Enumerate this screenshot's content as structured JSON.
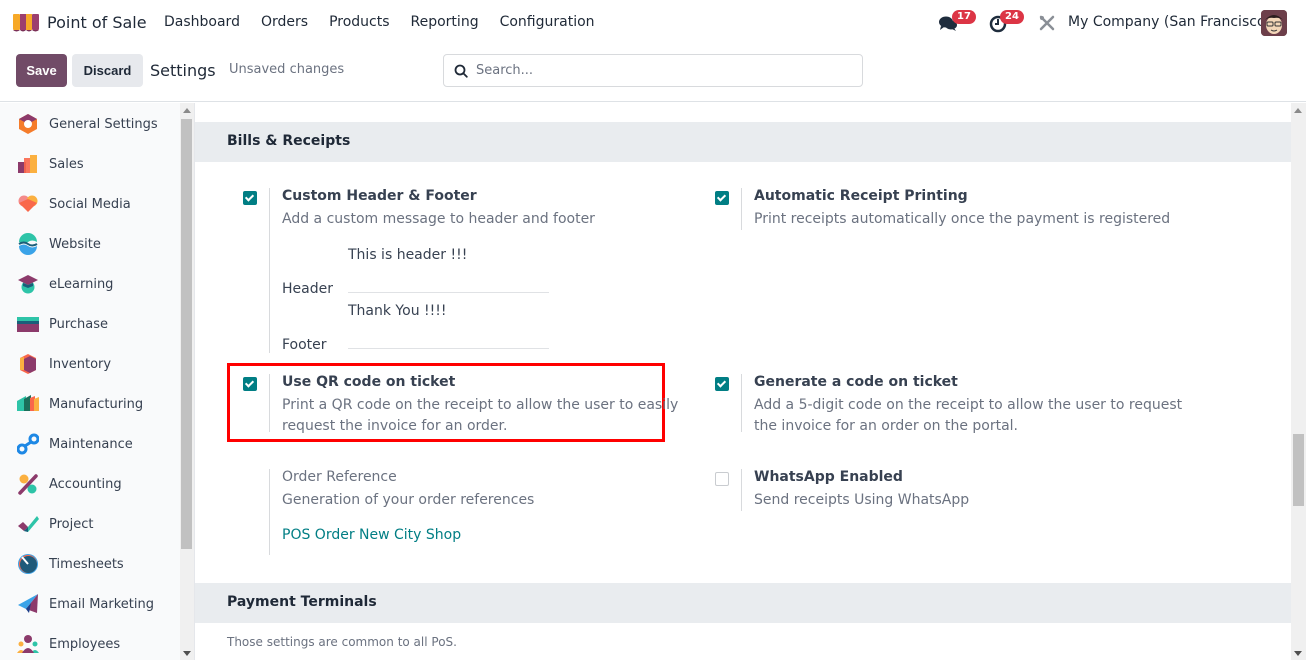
{
  "navbar": {
    "app_name": "Point of Sale",
    "menu": [
      "Dashboard",
      "Orders",
      "Products",
      "Reporting",
      "Configuration"
    ],
    "messages_count": "17",
    "activities_count": "24",
    "company": "My Company (San Francisco)"
  },
  "control_panel": {
    "save_label": "Save",
    "discard_label": "Discard",
    "title": "Settings",
    "status": "Unsaved changes",
    "search_placeholder": "Search..."
  },
  "sidebar": {
    "items": [
      {
        "label": "General Settings",
        "icon": "general-settings-icon"
      },
      {
        "label": "Sales",
        "icon": "sales-icon"
      },
      {
        "label": "Social Media",
        "icon": "social-media-icon"
      },
      {
        "label": "Website",
        "icon": "website-icon"
      },
      {
        "label": "eLearning",
        "icon": "elearning-icon"
      },
      {
        "label": "Purchase",
        "icon": "purchase-icon"
      },
      {
        "label": "Inventory",
        "icon": "inventory-icon"
      },
      {
        "label": "Manufacturing",
        "icon": "manufacturing-icon"
      },
      {
        "label": "Maintenance",
        "icon": "maintenance-icon"
      },
      {
        "label": "Accounting",
        "icon": "accounting-icon"
      },
      {
        "label": "Project",
        "icon": "project-icon"
      },
      {
        "label": "Timesheets",
        "icon": "timesheets-icon"
      },
      {
        "label": "Email Marketing",
        "icon": "email-marketing-icon"
      },
      {
        "label": "Employees",
        "icon": "employees-icon"
      }
    ]
  },
  "bills_receipts": {
    "title": "Bills & Receipts",
    "custom_header_footer": {
      "checked": true,
      "title": "Custom Header & Footer",
      "description": "Add a custom message to header and footer",
      "header_label": "Header",
      "header_value": "This is header !!!",
      "footer_label": "Footer",
      "footer_value": "Thank You !!!!"
    },
    "automatic_receipt_printing": {
      "checked": true,
      "title": "Automatic Receipt Printing",
      "description": "Print receipts automatically once the payment is registered"
    },
    "qr_code": {
      "checked": true,
      "title": "Use QR code on ticket",
      "description_line1": "Print a QR code on the receipt to allow the user to easily",
      "description_line2": "request the invoice for an order."
    },
    "generate_code": {
      "checked": true,
      "title": "Generate a code on ticket",
      "description_line1": "Add a 5-digit code on the receipt to allow the user to request",
      "description_line2": "the invoice for an order on the portal."
    },
    "order_reference": {
      "title": "Order Reference",
      "description": "Generation of your order references",
      "link": "POS Order New City Shop"
    },
    "whatsapp": {
      "checked": false,
      "title": "WhatsApp Enabled",
      "description": "Send receipts Using WhatsApp"
    }
  },
  "payment_terminals": {
    "title": "Payment Terminals",
    "note": "Those settings are common to all PoS."
  },
  "colors": {
    "brand": "#714b67",
    "checkbox": "#017e84",
    "highlight": "#ff0000",
    "badge": "#dc3545"
  }
}
